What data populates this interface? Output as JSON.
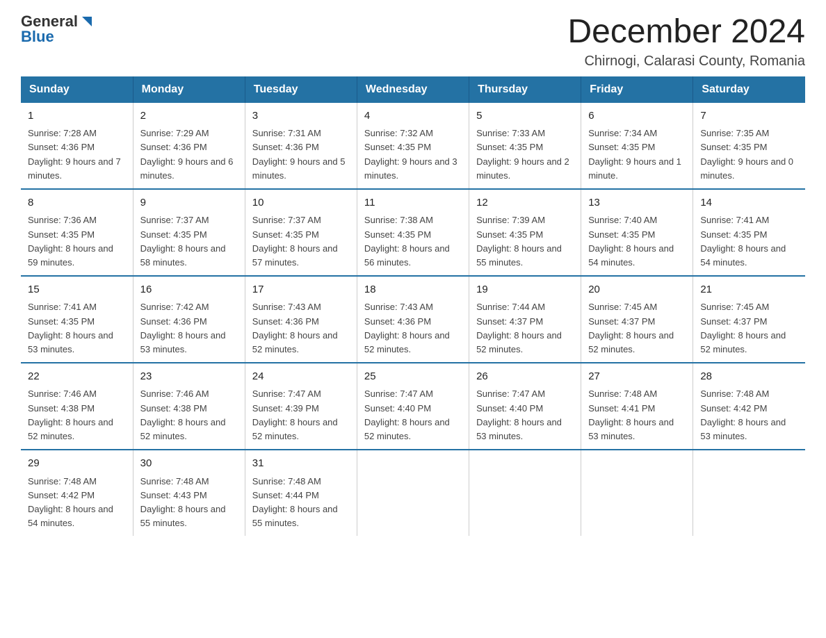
{
  "logo": {
    "general": "General",
    "blue": "Blue"
  },
  "title": "December 2024",
  "subtitle": "Chirnogi, Calarasi County, Romania",
  "weekdays": [
    "Sunday",
    "Monday",
    "Tuesday",
    "Wednesday",
    "Thursday",
    "Friday",
    "Saturday"
  ],
  "weeks": [
    [
      {
        "day": "1",
        "sunrise": "Sunrise: 7:28 AM",
        "sunset": "Sunset: 4:36 PM",
        "daylight": "Daylight: 9 hours and 7 minutes."
      },
      {
        "day": "2",
        "sunrise": "Sunrise: 7:29 AM",
        "sunset": "Sunset: 4:36 PM",
        "daylight": "Daylight: 9 hours and 6 minutes."
      },
      {
        "day": "3",
        "sunrise": "Sunrise: 7:31 AM",
        "sunset": "Sunset: 4:36 PM",
        "daylight": "Daylight: 9 hours and 5 minutes."
      },
      {
        "day": "4",
        "sunrise": "Sunrise: 7:32 AM",
        "sunset": "Sunset: 4:35 PM",
        "daylight": "Daylight: 9 hours and 3 minutes."
      },
      {
        "day": "5",
        "sunrise": "Sunrise: 7:33 AM",
        "sunset": "Sunset: 4:35 PM",
        "daylight": "Daylight: 9 hours and 2 minutes."
      },
      {
        "day": "6",
        "sunrise": "Sunrise: 7:34 AM",
        "sunset": "Sunset: 4:35 PM",
        "daylight": "Daylight: 9 hours and 1 minute."
      },
      {
        "day": "7",
        "sunrise": "Sunrise: 7:35 AM",
        "sunset": "Sunset: 4:35 PM",
        "daylight": "Daylight: 9 hours and 0 minutes."
      }
    ],
    [
      {
        "day": "8",
        "sunrise": "Sunrise: 7:36 AM",
        "sunset": "Sunset: 4:35 PM",
        "daylight": "Daylight: 8 hours and 59 minutes."
      },
      {
        "day": "9",
        "sunrise": "Sunrise: 7:37 AM",
        "sunset": "Sunset: 4:35 PM",
        "daylight": "Daylight: 8 hours and 58 minutes."
      },
      {
        "day": "10",
        "sunrise": "Sunrise: 7:37 AM",
        "sunset": "Sunset: 4:35 PM",
        "daylight": "Daylight: 8 hours and 57 minutes."
      },
      {
        "day": "11",
        "sunrise": "Sunrise: 7:38 AM",
        "sunset": "Sunset: 4:35 PM",
        "daylight": "Daylight: 8 hours and 56 minutes."
      },
      {
        "day": "12",
        "sunrise": "Sunrise: 7:39 AM",
        "sunset": "Sunset: 4:35 PM",
        "daylight": "Daylight: 8 hours and 55 minutes."
      },
      {
        "day": "13",
        "sunrise": "Sunrise: 7:40 AM",
        "sunset": "Sunset: 4:35 PM",
        "daylight": "Daylight: 8 hours and 54 minutes."
      },
      {
        "day": "14",
        "sunrise": "Sunrise: 7:41 AM",
        "sunset": "Sunset: 4:35 PM",
        "daylight": "Daylight: 8 hours and 54 minutes."
      }
    ],
    [
      {
        "day": "15",
        "sunrise": "Sunrise: 7:41 AM",
        "sunset": "Sunset: 4:35 PM",
        "daylight": "Daylight: 8 hours and 53 minutes."
      },
      {
        "day": "16",
        "sunrise": "Sunrise: 7:42 AM",
        "sunset": "Sunset: 4:36 PM",
        "daylight": "Daylight: 8 hours and 53 minutes."
      },
      {
        "day": "17",
        "sunrise": "Sunrise: 7:43 AM",
        "sunset": "Sunset: 4:36 PM",
        "daylight": "Daylight: 8 hours and 52 minutes."
      },
      {
        "day": "18",
        "sunrise": "Sunrise: 7:43 AM",
        "sunset": "Sunset: 4:36 PM",
        "daylight": "Daylight: 8 hours and 52 minutes."
      },
      {
        "day": "19",
        "sunrise": "Sunrise: 7:44 AM",
        "sunset": "Sunset: 4:37 PM",
        "daylight": "Daylight: 8 hours and 52 minutes."
      },
      {
        "day": "20",
        "sunrise": "Sunrise: 7:45 AM",
        "sunset": "Sunset: 4:37 PM",
        "daylight": "Daylight: 8 hours and 52 minutes."
      },
      {
        "day": "21",
        "sunrise": "Sunrise: 7:45 AM",
        "sunset": "Sunset: 4:37 PM",
        "daylight": "Daylight: 8 hours and 52 minutes."
      }
    ],
    [
      {
        "day": "22",
        "sunrise": "Sunrise: 7:46 AM",
        "sunset": "Sunset: 4:38 PM",
        "daylight": "Daylight: 8 hours and 52 minutes."
      },
      {
        "day": "23",
        "sunrise": "Sunrise: 7:46 AM",
        "sunset": "Sunset: 4:38 PM",
        "daylight": "Daylight: 8 hours and 52 minutes."
      },
      {
        "day": "24",
        "sunrise": "Sunrise: 7:47 AM",
        "sunset": "Sunset: 4:39 PM",
        "daylight": "Daylight: 8 hours and 52 minutes."
      },
      {
        "day": "25",
        "sunrise": "Sunrise: 7:47 AM",
        "sunset": "Sunset: 4:40 PM",
        "daylight": "Daylight: 8 hours and 52 minutes."
      },
      {
        "day": "26",
        "sunrise": "Sunrise: 7:47 AM",
        "sunset": "Sunset: 4:40 PM",
        "daylight": "Daylight: 8 hours and 53 minutes."
      },
      {
        "day": "27",
        "sunrise": "Sunrise: 7:48 AM",
        "sunset": "Sunset: 4:41 PM",
        "daylight": "Daylight: 8 hours and 53 minutes."
      },
      {
        "day": "28",
        "sunrise": "Sunrise: 7:48 AM",
        "sunset": "Sunset: 4:42 PM",
        "daylight": "Daylight: 8 hours and 53 minutes."
      }
    ],
    [
      {
        "day": "29",
        "sunrise": "Sunrise: 7:48 AM",
        "sunset": "Sunset: 4:42 PM",
        "daylight": "Daylight: 8 hours and 54 minutes."
      },
      {
        "day": "30",
        "sunrise": "Sunrise: 7:48 AM",
        "sunset": "Sunset: 4:43 PM",
        "daylight": "Daylight: 8 hours and 55 minutes."
      },
      {
        "day": "31",
        "sunrise": "Sunrise: 7:48 AM",
        "sunset": "Sunset: 4:44 PM",
        "daylight": "Daylight: 8 hours and 55 minutes."
      },
      null,
      null,
      null,
      null
    ]
  ]
}
